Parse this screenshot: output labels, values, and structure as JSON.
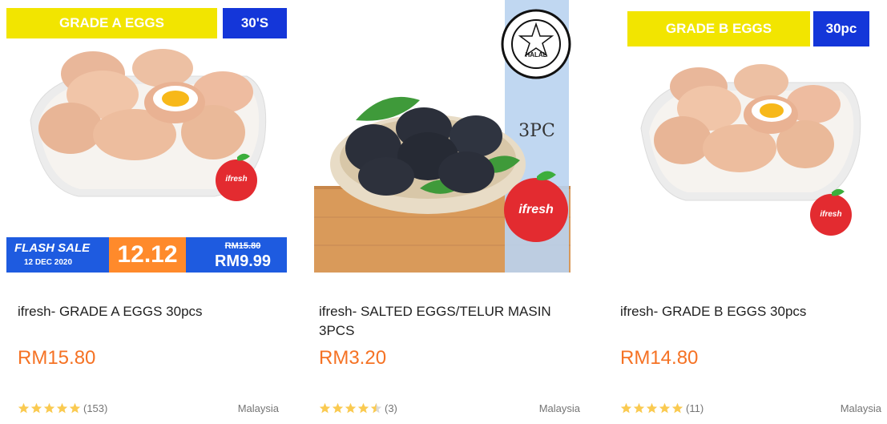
{
  "products": [
    {
      "image_label": "GRADE A EGGS",
      "image_badge": "30'S",
      "flash_sale": {
        "title": "FLASH SALE",
        "date": "12 DEC 2020",
        "event": "12.12",
        "old_price": "RM15.80",
        "new_price": "RM9.99"
      },
      "brand_logo_text": "ifresh",
      "title": "ifresh- GRADE A EGGS 30pcs",
      "price": "RM15.80",
      "rating": 5,
      "review_count": "(153)",
      "location": "Malaysia"
    },
    {
      "halal_text": "HALAL",
      "image_count_label": "3PC",
      "brand_logo_text": "ifresh",
      "title": "ifresh- SALTED EGGS/TELUR MASIN 3PCS",
      "price": "RM3.20",
      "rating": 4.5,
      "review_count": "(3)",
      "location": "Malaysia"
    },
    {
      "image_label": "GRADE B EGGS",
      "image_badge": "30pc",
      "brand_logo_text": "ifresh",
      "title": "ifresh- GRADE B EGGS 30pcs",
      "price": "RM14.80",
      "rating": 5,
      "review_count": "(11)",
      "location": "Malaysia"
    }
  ],
  "colors": {
    "price": "#f57224",
    "star": "#faca51",
    "banner_yellow": "#f2e500",
    "banner_blue": "#1436d9"
  }
}
